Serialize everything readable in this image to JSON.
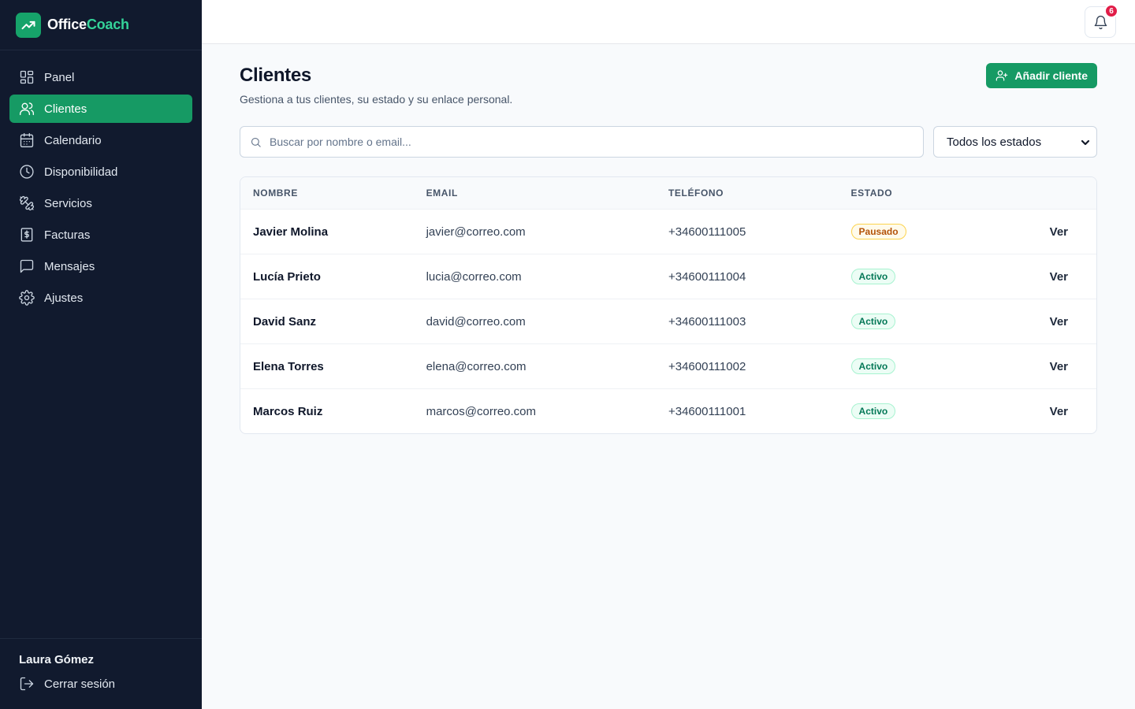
{
  "brand": {
    "part1": "Office",
    "part2": "Coach"
  },
  "sidebar": {
    "items": [
      {
        "label": "Panel",
        "icon": "dashboard-icon",
        "active": false
      },
      {
        "label": "Clientes",
        "icon": "users-icon",
        "active": true
      },
      {
        "label": "Calendario",
        "icon": "calendar-icon",
        "active": false
      },
      {
        "label": "Disponibilidad",
        "icon": "clock-icon",
        "active": false
      },
      {
        "label": "Servicios",
        "icon": "dumbbell-icon",
        "active": false
      },
      {
        "label": "Facturas",
        "icon": "receipt-icon",
        "active": false
      },
      {
        "label": "Mensajes",
        "icon": "message-icon",
        "active": false
      },
      {
        "label": "Ajustes",
        "icon": "gear-icon",
        "active": false
      }
    ],
    "user_name": "Laura Gómez",
    "logout_label": "Cerrar sesión"
  },
  "topbar": {
    "notification_count": "6"
  },
  "page": {
    "title": "Clientes",
    "subtitle": "Gestiona a tus clientes, su estado y su enlace personal.",
    "add_button_label": "Añadir cliente"
  },
  "filters": {
    "search_placeholder": "Buscar por nombre o email...",
    "status_selected": "Todos los estados"
  },
  "table": {
    "headers": [
      "NOMBRE",
      "EMAIL",
      "TELÉFONO",
      "ESTADO"
    ],
    "rows": [
      {
        "name": "Javier Molina",
        "email": "javier@correo.com",
        "phone": "+34600111005",
        "status": "Pausado",
        "action": "Ver"
      },
      {
        "name": "Lucía Prieto",
        "email": "lucia@correo.com",
        "phone": "+34600111004",
        "status": "Activo",
        "action": "Ver"
      },
      {
        "name": "David Sanz",
        "email": "david@correo.com",
        "phone": "+34600111003",
        "status": "Activo",
        "action": "Ver"
      },
      {
        "name": "Elena Torres",
        "email": "elena@correo.com",
        "phone": "+34600111002",
        "status": "Activo",
        "action": "Ver"
      },
      {
        "name": "Marcos Ruiz",
        "email": "marcos@correo.com",
        "phone": "+34600111001",
        "status": "Activo",
        "action": "Ver"
      }
    ]
  },
  "colors": {
    "sidebar_bg": "#111a2e",
    "accent": "#169a64",
    "badge_active": "#047857",
    "badge_paused": "#b45309",
    "notification": "#e11d48"
  }
}
